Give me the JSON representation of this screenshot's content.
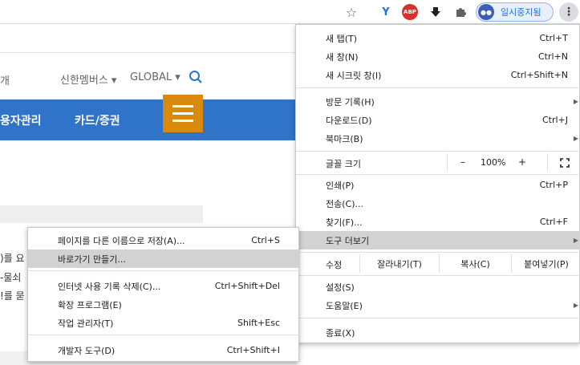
{
  "toolbar": {
    "profile_label": "일시중지됨",
    "abp_label": "ABP",
    "ext_y_label": "Y"
  },
  "page": {
    "nav_left_fragment": "개",
    "nav_members": "신한멤버스 ▾",
    "nav_global": "GLOBAL ▾",
    "menu_item_1": "용자관리",
    "menu_item_2": "카드/증권",
    "body_fragment_1": ")를 요",
    "body_fragment_2": "-물쇠",
    "body_fragment_3": "!를 묻"
  },
  "chrome_menu": {
    "new_tab": {
      "label": "새 탭(T)",
      "shortcut": "Ctrl+T"
    },
    "new_window": {
      "label": "새 창(N)",
      "shortcut": "Ctrl+N"
    },
    "incognito": {
      "label": "새 시크릿 창(I)",
      "shortcut": "Ctrl+Shift+N"
    },
    "history": {
      "label": "방문 기록(H)"
    },
    "downloads": {
      "label": "다운로드(D)",
      "shortcut": "Ctrl+J"
    },
    "bookmarks": {
      "label": "북마크(B)"
    },
    "zoom": {
      "label": "글꼴 크기",
      "minus": "–",
      "value": "100%",
      "plus": "+"
    },
    "print": {
      "label": "인쇄(P)",
      "shortcut": "Ctrl+P"
    },
    "cast": {
      "label": "전송(C)..."
    },
    "find": {
      "label": "찾기(F)...",
      "shortcut": "Ctrl+F"
    },
    "more_tools": {
      "label": "도구 더보기"
    },
    "edit": {
      "label": "수정",
      "cut": "잘라내기(T)",
      "copy": "복사(C)",
      "paste": "붙여넣기(P)"
    },
    "settings": {
      "label": "설정(S)"
    },
    "help": {
      "label": "도움말(E)"
    },
    "exit": {
      "label": "종료(X)"
    }
  },
  "submenu": {
    "save_page": {
      "label": "페이지를 다른 이름으로 저장(A)...",
      "shortcut": "Ctrl+S"
    },
    "create_shortcut": {
      "label": "바로가기 만들기..."
    },
    "clear_data": {
      "label": "인터넷 사용 기록 삭제(C)...",
      "shortcut": "Ctrl+Shift+Del"
    },
    "extensions": {
      "label": "확장 프로그램(E)"
    },
    "task_manager": {
      "label": "작업 관리자(T)",
      "shortcut": "Shift+Esc"
    },
    "dev_tools": {
      "label": "개발자 도구(D)",
      "shortcut": "Ctrl+Shift+I"
    }
  }
}
